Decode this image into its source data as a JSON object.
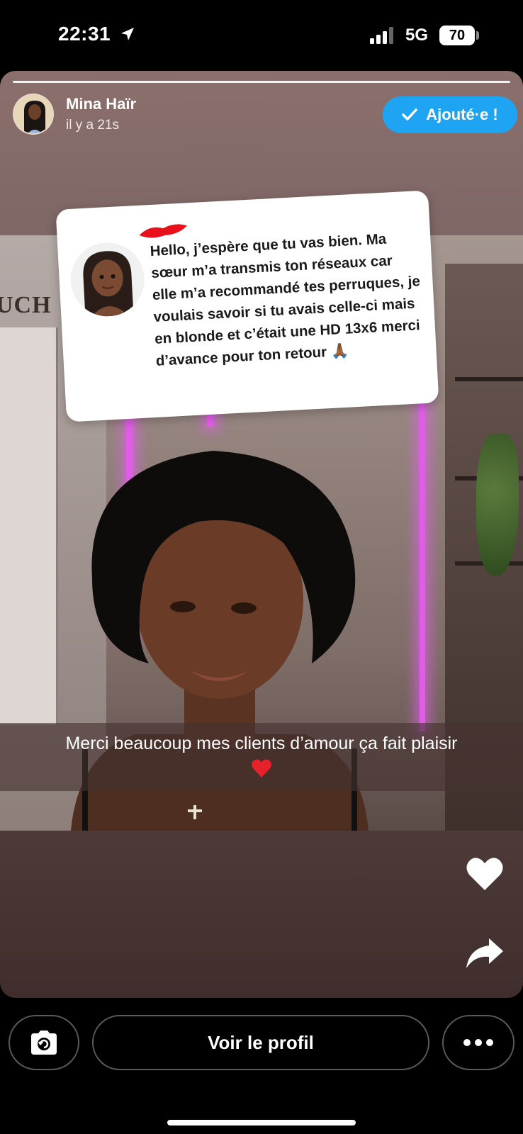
{
  "status_bar": {
    "time": "22:31",
    "network": "5G",
    "battery": "70",
    "icons": [
      "location-arrow-icon",
      "signal-bars-icon",
      "battery-icon"
    ]
  },
  "story": {
    "username": "Mina Haïr",
    "timestamp": "il y a 21s",
    "added_button": "Ajouté·e !",
    "question": {
      "text": "Hello, j’espère que tu vas bien. Ma sœur m’a transmis ton réseaux car elle m’a recommandé tes perruques, je voulais savoir si tu avais celle-ci mais en blonde et c’était une HD 13x6 merci d’avance pour ton retour",
      "emoji": "🙏🏾"
    },
    "background_sign": "UCH",
    "caption": "Merci beaucoup mes clients d’amour ça fait plaisir",
    "caption_emoji": "❤️"
  },
  "actions": {
    "like_icon": "heart-icon",
    "share_icon": "share-arrow-icon"
  },
  "bottom_bar": {
    "profile_button": "Voir le profil",
    "camera_icon": "camera-reply-icon",
    "more_icon": "more-dots-icon"
  },
  "colors": {
    "accent": "#1ea4f2",
    "background": "#000000",
    "neon": "#e15de8"
  }
}
